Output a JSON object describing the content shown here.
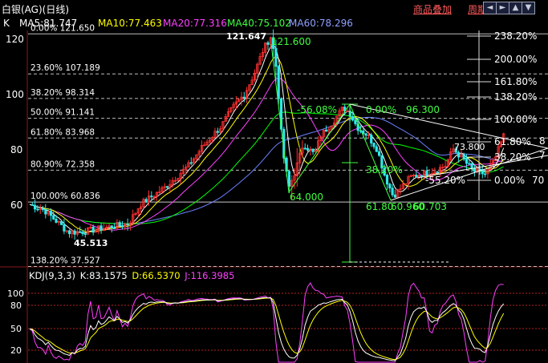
{
  "header": {
    "title": "白银(AG)(日线)",
    "menu_overlay": "商品叠加",
    "menu_period": "周期"
  },
  "window_buttons": [
    {
      "name": "prev-button",
      "icon": "left-arrow-icon",
      "glyph": "◄"
    },
    {
      "name": "next-button",
      "icon": "right-arrow-icon",
      "glyph": "►"
    },
    {
      "name": "zoom-in-button",
      "icon": "up-arrow-icon",
      "glyph": "▲"
    },
    {
      "name": "zoom-out-button",
      "icon": "down-arrow-icon",
      "glyph": "▼"
    },
    {
      "name": "close-button",
      "icon": "close-icon",
      "glyph": "×"
    }
  ],
  "ma_bar": {
    "k_label": "K",
    "ma5": "MA5:81.747",
    "ma10": "MA10:77.463",
    "ma20": "MA20:77.316",
    "ma40": "MA40:75.102",
    "ma60": "MA60:78.296"
  },
  "colors": {
    "up": "#ff3030",
    "down": "#30e8e8",
    "ma5": "#ffffff",
    "ma10": "#ffff00",
    "ma20": "#ff40ff",
    "ma40": "#00ff00",
    "ma60": "#6a80ff",
    "fib": "#ffffff",
    "annot": "#40ff40",
    "grid": "#8b1a1a"
  },
  "y_axis": {
    "ticks": [
      "120",
      "100",
      "80",
      "60"
    ]
  },
  "fib_levels": [
    {
      "label": "0.00% 121.650",
      "value": 121.65
    },
    {
      "label": "23.60% 107.189",
      "value": 107.189
    },
    {
      "label": "38.20% 98.314",
      "value": 98.314
    },
    {
      "label": "50.00% 91.141",
      "value": 91.141
    },
    {
      "label": "61.80% 83.968",
      "value": 83.968
    },
    {
      "label": "80.90% 72.358",
      "value": 72.358
    },
    {
      "label": "100.00% 60.836",
      "value": 60.836
    },
    {
      "label": "138.20% 37.527",
      "value": 37.527
    }
  ],
  "right_fib": [
    "238.20%",
    "200.00%",
    "161.80%",
    "138.20%",
    "100.00%",
    "61.80%",
    "38.20%",
    "0.00%"
  ],
  "right_extra": [
    "8",
    "7",
    "70"
  ],
  "annotations": {
    "high": "121.647",
    "high2": "121.600",
    "low": "45.513",
    "pct_neg56": "-56.08%",
    "pct_zero": "0.00%",
    "p96": "96.300",
    "p64": "64.000",
    "pct_38": "38.20%",
    "pct_618": "61.80",
    "p60": "60.960",
    "p60b": "60.703",
    "pct_neg55": "-55.20%",
    "p73": "73.800"
  },
  "kdj_bar": {
    "label": "KDJ(9,3,3)",
    "k": "K:83.1575",
    "d": "D:66.5370",
    "j": "J:116.3985"
  },
  "kdj_axis": {
    "ticks": [
      "100",
      "80",
      "50",
      "20"
    ]
  }
}
